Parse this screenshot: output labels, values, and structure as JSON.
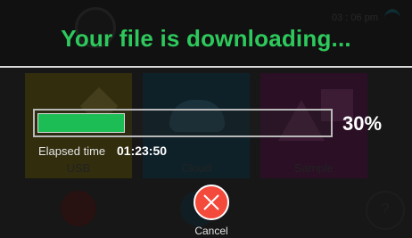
{
  "background": {
    "clock": "03 : 06 pm",
    "tiles": [
      {
        "label": "USB"
      },
      {
        "label": "Cloud"
      },
      {
        "label": "Sample"
      }
    ],
    "help_glyph": "?"
  },
  "dialog": {
    "title": "Your file is downloading...",
    "progress_fraction": 0.3,
    "progress_percent_text": "30%",
    "elapsed_label": "Elapsed time",
    "elapsed_value": "01:23:50",
    "cancel_label": "Cancel",
    "colors": {
      "title": "#2ec95c",
      "progress_fill": "#1dbd55",
      "cancel_button": "#f34a3b"
    },
    "icons": {
      "cancel": "close-icon"
    }
  }
}
